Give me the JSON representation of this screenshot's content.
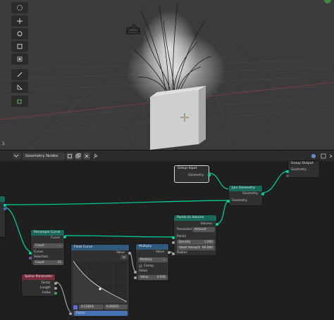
{
  "editor": {
    "type_label": "Geometry Nodes",
    "tree_name": "Geometry Nodes",
    "frame_label": "1"
  },
  "nodes": {
    "group_input": {
      "title": "Group Input",
      "out": "Geometry"
    },
    "group_output": {
      "title": "Group Output",
      "in": "Geometry"
    },
    "join_geometry": {
      "title": "Join Geometry",
      "in": "Geometry",
      "out": "Geometry"
    },
    "points_to_volume": {
      "title": "Points to Volume",
      "out": "Volume",
      "points": "Points",
      "resolution_label": "Resolution",
      "resolution_value": "Amount",
      "density_label": "Density",
      "density_value": "1.000",
      "voxel_label": "Voxel Amount",
      "voxel_value": "64.000",
      "radius_label": "Radius"
    },
    "resample_curve": {
      "title": "Resample Curve",
      "out": "Curve",
      "mode": "Count",
      "curve": "Curve",
      "selection": "Selection",
      "count_label": "Count",
      "count_value": "25"
    },
    "float_curve": {
      "title": "Float Curve",
      "out": "Value",
      "point_x": "0.51818",
      "point_y": "0.40625",
      "factor": "Factor"
    },
    "multiply": {
      "title": "Multiply",
      "out": "Value",
      "op": "Multiply",
      "clamp": "Clamp",
      "value_label": "Value",
      "value2_label": "Value",
      "value2": "0.500"
    },
    "spline_parameter": {
      "title": "Spline Parameter",
      "factor": "Factor",
      "length": "Length",
      "index": "Index"
    }
  },
  "colors": {
    "geometry_socket": "#00d6a3",
    "float_socket": "#a1a1a1",
    "header_geometry": "#19695a",
    "header_attribute": "#7a2b3b",
    "header_math": "#2f5a7e",
    "header_group": "#2e2e2e"
  }
}
